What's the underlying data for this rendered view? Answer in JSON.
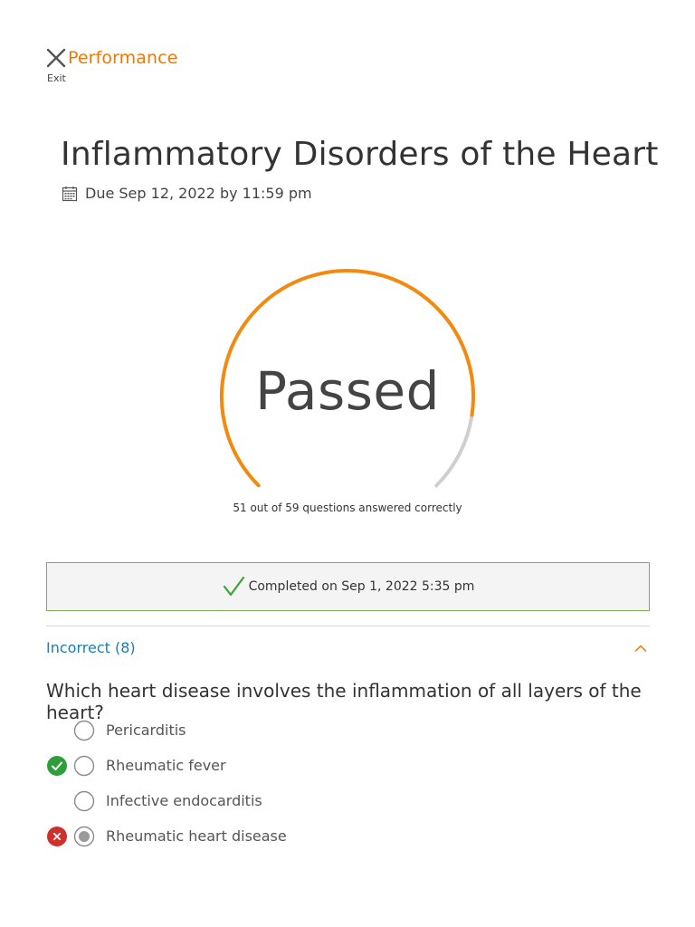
{
  "header": {
    "app_title": "Performance",
    "exit_label": "Exit"
  },
  "assignment": {
    "title": "Inflammatory Disorders of the Heart",
    "due": "Due Sep 12, 2022 by 11:59 pm"
  },
  "result": {
    "status": "Passed",
    "caption": "51 out of 59 questions answered correctly",
    "correct": 51,
    "total": 59,
    "colors": {
      "progress": "#f28a10",
      "remainder": "#cfcfcf"
    }
  },
  "completion": {
    "text": "Completed on Sep 1, 2022 5:35 pm",
    "color": "#3aa535"
  },
  "incorrect_section": {
    "title": "Incorrect (8)",
    "expanded": true,
    "accent": "#f07800",
    "question": {
      "text": "Which heart disease involves the inflammation of all layers of the heart?",
      "options": [
        {
          "label": "Pericarditis",
          "selected": false,
          "status": ""
        },
        {
          "label": "Rheumatic fever",
          "selected": false,
          "status": "correct"
        },
        {
          "label": "Infective endocarditis",
          "selected": false,
          "status": ""
        },
        {
          "label": "Rheumatic heart disease",
          "selected": true,
          "status": "incorrect"
        }
      ]
    }
  },
  "icons": {
    "exit": "close-x-icon",
    "due": "calendar-icon",
    "completion": "checkmark-icon",
    "collapse": "chevron-up-icon",
    "correct": "check-circle-icon",
    "incorrect": "x-circle-icon"
  }
}
